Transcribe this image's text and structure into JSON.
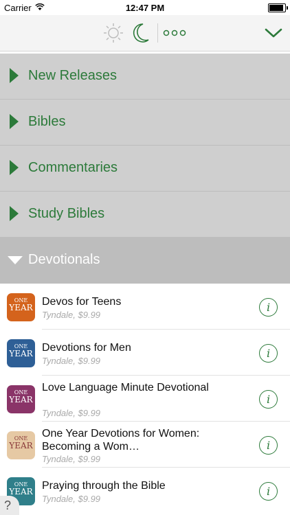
{
  "status_bar": {
    "carrier": "Carrier",
    "time": "12:47 PM"
  },
  "toolbar": {
    "icons": [
      "sun-icon",
      "moon-icon",
      "more-icon",
      "chevron-down-icon"
    ]
  },
  "categories": [
    {
      "label": "New Releases",
      "expanded": false
    },
    {
      "label": "Bibles",
      "expanded": false
    },
    {
      "label": "Commentaries",
      "expanded": false
    },
    {
      "label": "Study Bibles",
      "expanded": false
    },
    {
      "label": "Devotionals",
      "expanded": true
    }
  ],
  "books": [
    {
      "title": "Devos for Teens",
      "subtitle": "Tyndale, $9.99",
      "cover_one": "ONE",
      "cover_year": "YEAR",
      "cover_color": "#d4631c"
    },
    {
      "title": "Devotions for Men",
      "subtitle": "Tyndale, $9.99",
      "cover_one": "ONE",
      "cover_year": "YEAR",
      "cover_color": "#2e5f96"
    },
    {
      "title": "Love Language Minute Devotional",
      "subtitle": "Tyndale, $9.99",
      "cover_one": "ONE",
      "cover_year": "YEAR",
      "cover_color": "#8a3468"
    },
    {
      "title": "One Year Devotions for Women: Becoming a Wom…",
      "subtitle": "Tyndale, $9.99",
      "cover_one": "ONE",
      "cover_year": "YEAR",
      "cover_color": "#e6c9a4"
    },
    {
      "title": "Praying through the Bible",
      "subtitle": "Tyndale, $9.99",
      "cover_one": "ONE",
      "cover_year": "YEAR",
      "cover_color": "#2f7f8a"
    }
  ],
  "help": {
    "label": "?"
  },
  "colors": {
    "accent": "#2c7a3a",
    "category_bg": "#cfcfcf"
  }
}
